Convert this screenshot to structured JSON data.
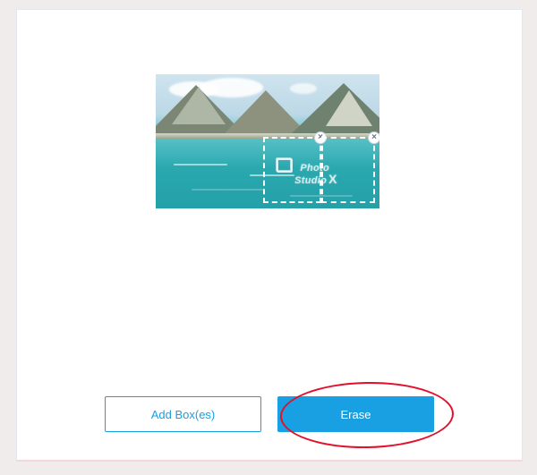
{
  "buttons": {
    "add_box_label": "Add Box(es)",
    "erase_label": "Erase"
  },
  "selection_boxes": {
    "close_glyph": "×"
  },
  "watermark": {
    "line1": "Photo",
    "line2": "Studio",
    "suffix": "X"
  },
  "colors": {
    "accent": "#18a0e2",
    "highlight": "#e2102a"
  }
}
